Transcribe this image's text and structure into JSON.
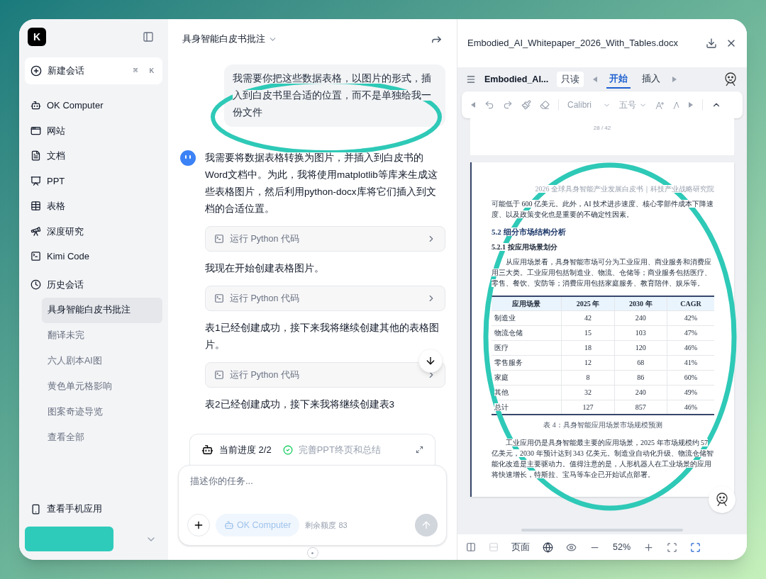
{
  "sidebar": {
    "logo": "K",
    "new_chat": {
      "label": "新建会话",
      "shortcut": [
        "⌘",
        "K"
      ]
    },
    "nav": [
      "OK Computer",
      "网站",
      "文档",
      "PPT",
      "表格",
      "深度研究",
      "Kimi Code"
    ],
    "history": {
      "title": "历史会话",
      "items": [
        {
          "label": "具身智能白皮书批注",
          "selected": true
        },
        {
          "label": "翻译未完",
          "selected": false
        },
        {
          "label": "六人剧本AI图",
          "selected": false
        },
        {
          "label": "黄色单元格影响",
          "selected": false
        },
        {
          "label": "图案奇迹导览",
          "selected": false
        }
      ],
      "view_all": "查看全部"
    },
    "mobile": "查看手机应用"
  },
  "chat": {
    "title": "具身智能白皮书批注",
    "user_message": "我需要你把这些数据表格，以图片的形式，插入到白皮书里合适的位置，而不是单独给我一份文件",
    "messages": [
      {
        "kind": "text",
        "text": "我需要将数据表格转换为图片，并插入到白皮书的Word文档中。为此，我将使用matplotlib等库来生成这些表格图片，然后利用python-docx库将它们插入到文档的合适位置。"
      },
      {
        "kind": "tool",
        "text": "运行 Python 代码"
      },
      {
        "kind": "text",
        "text": "我现在开始创建表格图片。"
      },
      {
        "kind": "tool",
        "text": "运行 Python 代码"
      },
      {
        "kind": "text",
        "text": "表1已经创建成功，接下来我将继续创建其他的表格图片。"
      },
      {
        "kind": "tool",
        "text": "运行 Python 代码"
      },
      {
        "kind": "text",
        "text": "表2已经创建成功，接下来我将继续创建表3"
      }
    ],
    "progress": {
      "label": "当前进度 2/2",
      "step": "完善PPT终页和总结",
      "done": true
    },
    "input": {
      "placeholder": "描述你的任务...",
      "mode": "OK Computer",
      "quota": "剩余额度 83",
      "send_disabled": true
    }
  },
  "document": {
    "title": "Embodied_AI_Whitepaper_2026_With_Tables.docx",
    "short_name": "Embodied_AI...",
    "badge": "只读",
    "tabs": [
      {
        "label": "开始",
        "selected": true
      },
      {
        "label": "插入",
        "selected": false
      }
    ],
    "font": "Calibri",
    "size": "五号",
    "prev_page_number": "28 / 42",
    "page": {
      "header": "2026 全球具身智能产业发展白皮书｜科技产业战略研究院",
      "para1": "可能低于 600 亿美元。此外，AI 技术进步速度、核心零部件成本下降速度、以及政策变化也是重要的不确定性因素。",
      "heading": "5.2 细分市场结构分析",
      "subheading": "5.2.1 按应用场景划分",
      "para2": "从应用场景看，具身智能市场可分为工业应用、商业服务和消费应用三大类。工业应用包括制造业、物流、仓储等；商业服务包括医疗、零售、餐饮、安防等；消费应用包括家庭服务、教育陪伴、娱乐等。",
      "table": {
        "columns": [
          "应用场景",
          "2025 年",
          "2030 年",
          "CAGR"
        ],
        "rows": [
          [
            "制造业",
            "42",
            "240",
            "42%"
          ],
          [
            "物流仓储",
            "15",
            "103",
            "47%"
          ],
          [
            "医疗",
            "18",
            "120",
            "46%"
          ],
          [
            "零售服务",
            "12",
            "68",
            "41%"
          ],
          [
            "家庭",
            "8",
            "86",
            "60%"
          ],
          [
            "其他",
            "32",
            "240",
            "49%"
          ],
          [
            "总计",
            "127",
            "857",
            "46%"
          ]
        ]
      },
      "caption": "表 4：具身智能应用场景市场规模预测",
      "para3": "工业应用仍是具身智能最主要的应用场景，2025 年市场规模约 57 亿美元，2030 年预计达到 343 亿美元。制造业自动化升级、物流仓储智能化改造是主要驱动力。值得注意的是，人形机器人在工业场景的应用将快速增长，特斯拉、宝马等车企已开始试点部署。"
    },
    "status": {
      "view": "页面",
      "zoom": "52%"
    }
  }
}
